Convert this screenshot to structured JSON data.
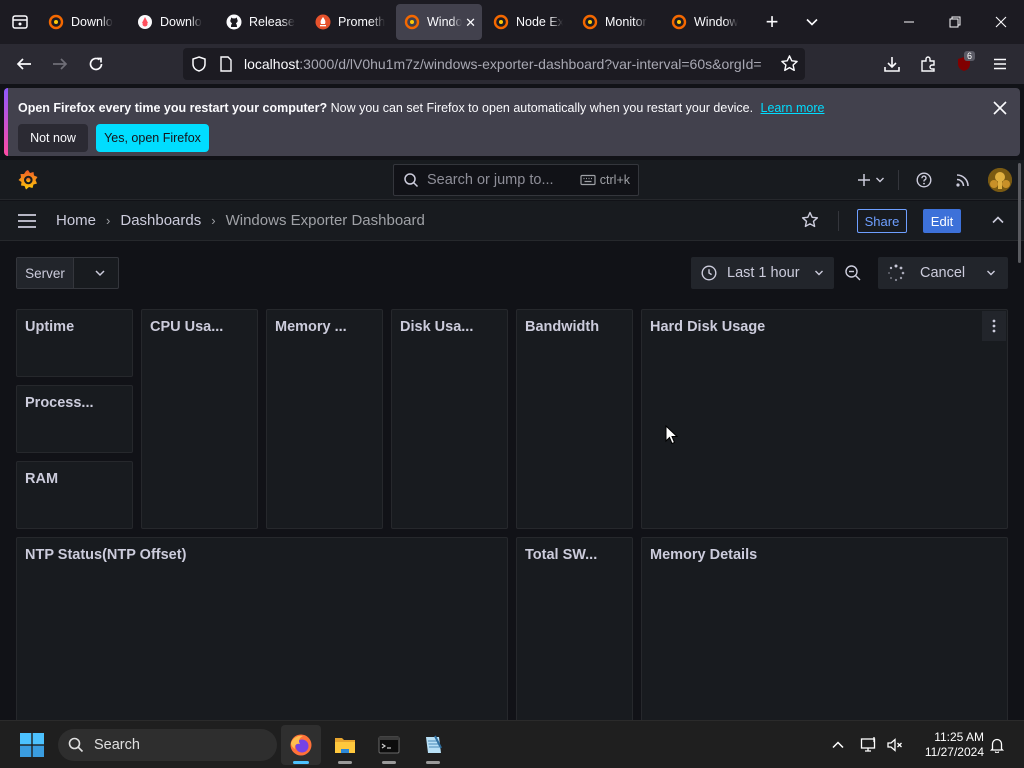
{
  "browser": {
    "tabs": [
      {
        "label": "Downlo",
        "icon": "grafana-icon",
        "active": false
      },
      {
        "label": "Downlo",
        "icon": "firefox-download-icon",
        "active": false
      },
      {
        "label": "Release",
        "icon": "github-icon",
        "active": false
      },
      {
        "label": "Prometh",
        "icon": "prometheus-icon",
        "active": false
      },
      {
        "label": "Windo",
        "icon": "grafana-icon",
        "active": true
      },
      {
        "label": "Node Ex",
        "icon": "grafana-icon",
        "active": false
      },
      {
        "label": "Monitor",
        "icon": "grafana-icon",
        "active": false
      },
      {
        "label": "Window",
        "icon": "grafana-icon",
        "active": false
      }
    ],
    "url_host": "localhost",
    "url_path": ":3000/d/lV0hu1m7z/windows-exporter-dashboard?var-interval=60s&orgId=",
    "extension_badge": "6"
  },
  "notification": {
    "title": "Open Firefox every time you restart your computer?",
    "message": "Now you can set Firefox to open automatically when you restart your device.",
    "learn_more": "Learn more",
    "not_now": "Not now",
    "yes_open": "Yes, open Firefox"
  },
  "grafana": {
    "search_placeholder": "Search or jump to...",
    "search_shortcut": "ctrl+k",
    "breadcrumbs": [
      "Home",
      "Dashboards",
      "Windows Exporter Dashboard"
    ],
    "share_label": "Share",
    "edit_label": "Edit",
    "variable_label": "Server",
    "variable_value": "",
    "time_range": "Last 1 hour",
    "cancel_label": "Cancel",
    "panels": {
      "uptime": "Uptime",
      "processes": "Process...",
      "ram": "RAM",
      "cpu_usage": "CPU Usa...",
      "memory": "Memory ...",
      "disk_usage": "Disk Usa...",
      "bandwidth": "Bandwidth",
      "hard_disk_usage": "Hard Disk Usage",
      "ntp_status": "NTP Status(NTP Offset)",
      "total_sw": "Total SW...",
      "memory_details": "Memory Details"
    }
  },
  "taskbar": {
    "search_label": "Search",
    "time": "11:25 AM",
    "date": "11/27/2024"
  },
  "colors": {
    "grafana_bg": "#111217",
    "panel_bg": "#181b1f",
    "accent_blue": "#3d71d9",
    "firefox_cyan": "#00ddff"
  }
}
